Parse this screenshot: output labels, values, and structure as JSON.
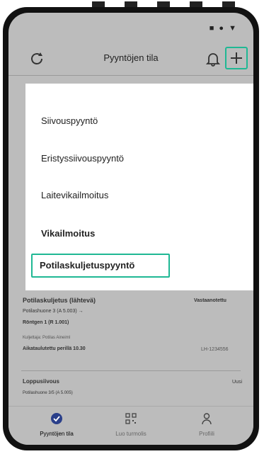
{
  "status_bar": {
    "icons": "■ ● ▼"
  },
  "app_bar": {
    "title": "Pyyntöjen tila",
    "left_icon": "refresh-icon",
    "right_icons": [
      "bell-icon",
      "plus-icon"
    ]
  },
  "menu": {
    "items": [
      {
        "label": "Siivouspyyntö"
      },
      {
        "label": "Eristyssiivouspyyntö"
      },
      {
        "label": "Laitevikailmoitus"
      },
      {
        "label": "Vikailmoitus"
      },
      {
        "label": "Potilaskuljetuspyyntö"
      }
    ]
  },
  "request_card": {
    "title": "Potilaskuljetus (lähtevä)",
    "status": "Vastaanotettu",
    "route": "Potilashuone 3 (A 5.003) →",
    "destination": "Röntgen 1 (R 1.001)",
    "assignee": "Kuljettaja: Potilas Aineiml",
    "schedule": "Aikataulutettu perillä 10.30",
    "id": "LH-1234556"
  },
  "second_card": {
    "title": "Loppusiivous",
    "status": "Uusi",
    "location": "Potilashuone 3/5 (A 5.005)"
  },
  "bottom_nav": {
    "items": [
      {
        "label": "Pyyntöjen tila",
        "icon": "check-circle-icon"
      },
      {
        "label": "Luo turmolis",
        "icon": "qr-code-icon"
      },
      {
        "label": "Profiili",
        "icon": "person-icon"
      }
    ]
  },
  "colors": {
    "accent": "#1fb894",
    "overlay": "#bcbcbc",
    "nav_icon": "#2a3f8a"
  }
}
